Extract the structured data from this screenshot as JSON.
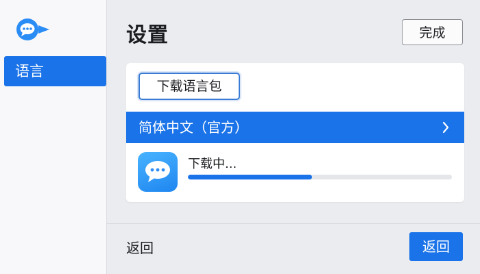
{
  "sidebar": {
    "logo_icon": "chat-bubble-icon",
    "items": [
      {
        "label": "语言",
        "selected": true
      }
    ]
  },
  "header": {
    "title": "设置",
    "done_label": "完成"
  },
  "card": {
    "download_pack_label": "下载语言包",
    "language_option": {
      "label": "简体中文（官方）",
      "icon": "chevron-right-icon"
    },
    "download": {
      "app_icon": "chat-bubble-icon",
      "status": "下载中...",
      "progress": 0.47
    }
  },
  "footer": {
    "back_link_label": "返回",
    "back_button_label": "返回"
  },
  "colors": {
    "accent": "#1a73e8",
    "background": "#eaecf0",
    "sidebar": "#f8f8fa"
  }
}
